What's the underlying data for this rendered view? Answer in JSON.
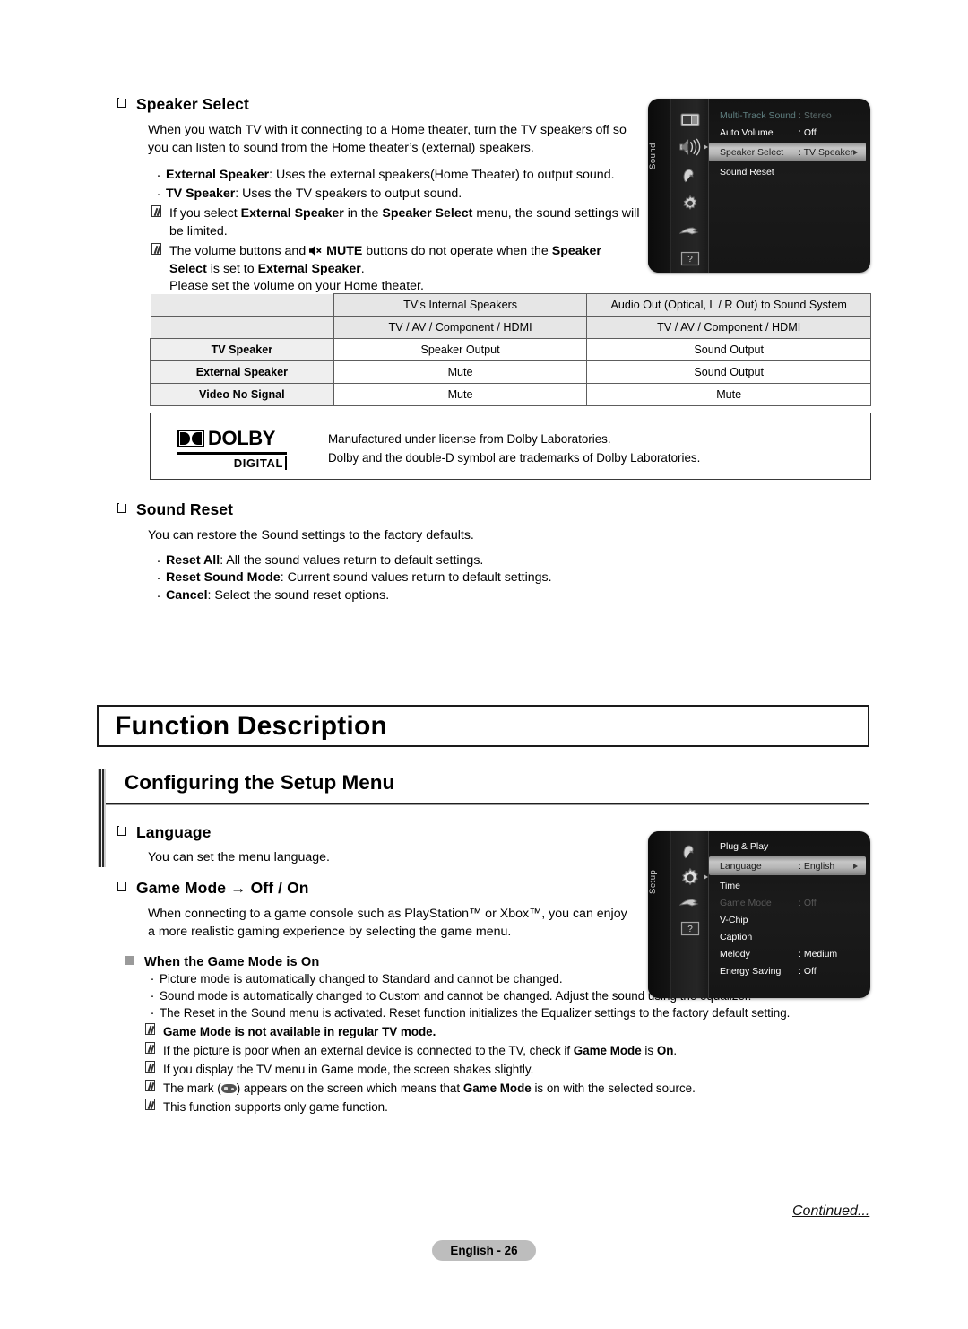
{
  "speaker_select": {
    "heading": "Speaker Select",
    "intro": "When you watch TV with it connecting to a Home theater, turn the TV speakers off so you can listen to sound from the Home theater’s (external) speakers.",
    "bullets": [
      {
        "bold": "External Speaker",
        "rest": ": Uses the external speakers(Home Theater) to output sound."
      },
      {
        "bold": "TV Speaker",
        "rest": ": Uses the TV speakers to output sound."
      }
    ],
    "note1_a": "If you select ",
    "note1_b": "External Speaker",
    "note1_c": " in the ",
    "note1_d": "Speaker Select",
    "note1_e": " menu, the sound settings will be limited.",
    "note2_a": "The volume buttons and ",
    "note2_mute": "MUTE",
    "note2_b": " buttons do not operate when the ",
    "note2_c": "Speaker Select",
    "note2_d": " is set to ",
    "note2_e": "External Speaker",
    "note2_f": ".",
    "note2_g": "Please set the volume on your Home theater."
  },
  "speaker_table": {
    "header_row1": [
      "",
      "TV's Internal Speakers",
      "Audio Out (Optical, L / R Out) to Sound System"
    ],
    "header_row2": [
      "",
      "TV / AV / Component / HDMI",
      "TV / AV / Component / HDMI"
    ],
    "rows": [
      {
        "label": "TV Speaker",
        "internal": "Speaker Output",
        "audio_out": "Sound Output"
      },
      {
        "label": "External Speaker",
        "internal": "Mute",
        "audio_out": "Sound Output"
      },
      {
        "label": "Video No Signal",
        "internal": "Mute",
        "audio_out": "Mute"
      }
    ]
  },
  "dolby": {
    "word": "DOLBY",
    "sub": "DIGITAL",
    "line1": "Manufactured under license from Dolby Laboratories.",
    "line2": "Dolby and the double-D symbol are trademarks of Dolby Laboratories."
  },
  "sound_reset": {
    "heading": "Sound Reset",
    "intro": "You can restore the Sound settings to the factory defaults.",
    "bullets": [
      {
        "bold": "Reset All",
        "rest": ": All the sound values return to default settings."
      },
      {
        "bold": "Reset Sound Mode",
        "rest": ": Current sound values return to default settings."
      },
      {
        "bold": "Cancel",
        "rest": ": Select the sound reset options."
      }
    ]
  },
  "function_description": {
    "title": "Function Description"
  },
  "setup_section": {
    "title": "Configuring the Setup Menu"
  },
  "language": {
    "heading": "Language",
    "text": "You can set the menu language."
  },
  "game_mode": {
    "heading_a": "Game Mode",
    "heading_arrow": " → ",
    "heading_b": "Off / On",
    "intro": "When connecting to a game console such as PlayStation™ or Xbox™, you can enjoy a more realistic gaming experience by selecting the game menu.",
    "subheading": "When the Game Mode is On",
    "bullets": [
      "Picture mode is automatically changed to Standard and cannot be changed.",
      "Sound mode is automatically changed to Custom and cannot be changed. Adjust the sound using the equalizer.",
      "The Reset in the Sound menu is activated. Reset function initializes the Equalizer settings to the factory default setting."
    ],
    "notes": [
      {
        "segments": [
          {
            "t": "Game Mode is not available in regular TV mode.",
            "b": true
          }
        ]
      },
      {
        "segments": [
          {
            "t": "If the picture is poor when an external device is connected to the TV, check if ",
            "b": false
          },
          {
            "t": "Game Mode",
            "b": true
          },
          {
            "t": " is ",
            "b": false
          },
          {
            "t": "On",
            "b": true
          },
          {
            "t": ".",
            "b": false
          }
        ]
      },
      {
        "segments": [
          {
            "t": "If you display the TV menu in Game mode, the screen shakes slightly.",
            "b": false
          }
        ]
      },
      {
        "segments": [
          {
            "t": "The mark (",
            "b": false
          },
          {
            "t": " GAMEPAD ",
            "b": false,
            "icon": true
          },
          {
            "t": ") appears on the screen which means that ",
            "b": false
          },
          {
            "t": "Game Mode",
            "b": true
          },
          {
            "t": " is on with the selected source.",
            "b": false
          }
        ]
      },
      {
        "segments": [
          {
            "t": "This function supports only game function.",
            "b": false
          }
        ]
      }
    ]
  },
  "osd_sound": {
    "side_label": "Sound",
    "icons": [
      "picture-icon",
      "sound-icon",
      "input-icon",
      "setup-icon",
      "network-icon",
      "support-icon"
    ],
    "rows": [
      {
        "label": "Multi-Track Sound",
        "value": ": Stereo",
        "state": "dim"
      },
      {
        "label": "Auto Volume",
        "value": ": Off",
        "state": "normal"
      },
      {
        "label": "Speaker Select",
        "value": ": TV Speaker",
        "state": "selected",
        "arrow": true
      },
      {
        "label": "Sound Reset",
        "value": "",
        "state": "normal"
      }
    ]
  },
  "osd_setup": {
    "side_label": "Setup",
    "icons": [
      "input-icon",
      "setup-icon",
      "network-icon",
      "support-icon"
    ],
    "rows": [
      {
        "label": "Plug & Play",
        "value": "",
        "state": "normal"
      },
      {
        "label": "Language",
        "value": ": English",
        "state": "selected",
        "arrow": true
      },
      {
        "label": "Time",
        "value": "",
        "state": "normal"
      },
      {
        "label": "Game Mode",
        "value": ": Off",
        "state": "dimgray"
      },
      {
        "label": "V-Chip",
        "value": "",
        "state": "normal"
      },
      {
        "label": "Caption",
        "value": "",
        "state": "normal"
      },
      {
        "label": "Melody",
        "value": ": Medium",
        "state": "normal"
      },
      {
        "label": "Energy Saving",
        "value": ": Off",
        "state": "normal"
      }
    ]
  },
  "footer": {
    "continued": "Continued...",
    "page": "English - 26"
  },
  "colors": {
    "selected_menu": "#c6c6c6",
    "dim_teal": "#5f7f80",
    "page_badge": "#bdbdbd"
  }
}
